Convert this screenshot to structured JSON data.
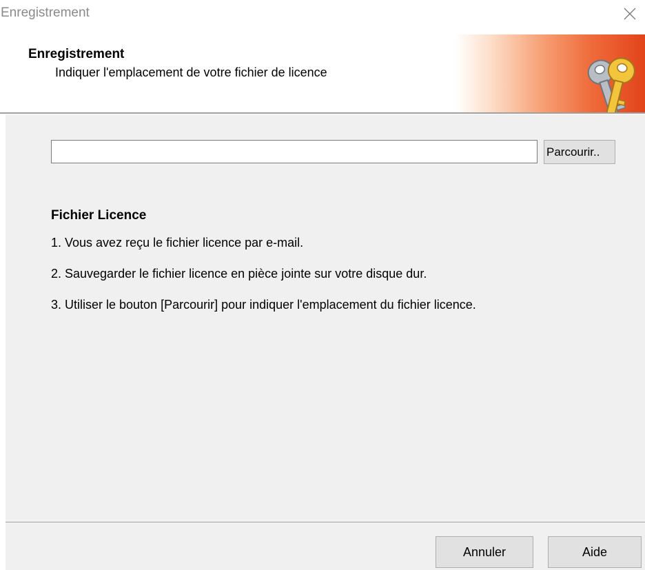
{
  "window": {
    "title": "Enregistrement",
    "close_icon": "close-icon"
  },
  "header": {
    "title": "Enregistrement",
    "subtitle": "Indiquer l'emplacement de votre fichier de licence",
    "icon": "keys-icon",
    "accent_color": "#e2441a"
  },
  "file_picker": {
    "path_value": "",
    "browse_label": "Parcourir.."
  },
  "license_section": {
    "title": "Fichier Licence",
    "steps": [
      "1. Vous avez reçu le fichier licence par e-mail.",
      "2. Sauvegarder le fichier licence en pièce jointe sur votre disque dur.",
      "3. Utiliser le bouton [Parcourir] pour indiquer l'emplacement du fichier licence."
    ]
  },
  "footer": {
    "cancel_label": "Annuler",
    "help_label": "Aide"
  }
}
